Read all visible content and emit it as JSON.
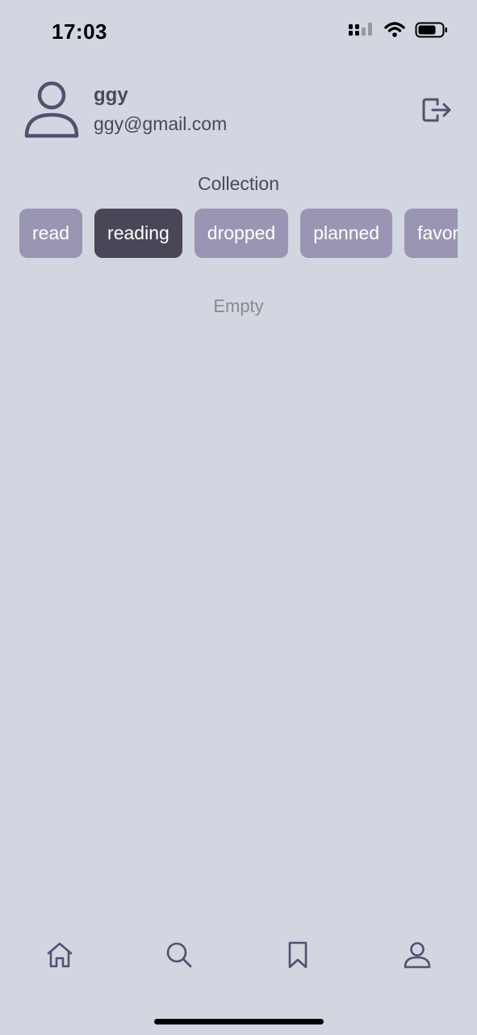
{
  "status_bar": {
    "time": "17:03",
    "icons": [
      "signal-icon",
      "wifi-icon",
      "battery-icon"
    ]
  },
  "profile": {
    "name": "ggy",
    "email": "ggy@gmail.com",
    "avatar_icon": "person-icon",
    "logout_icon": "logout-icon"
  },
  "collection": {
    "title": "Collection",
    "tabs": [
      {
        "label": "read",
        "active": false
      },
      {
        "label": "reading",
        "active": true
      },
      {
        "label": "dropped",
        "active": false
      },
      {
        "label": "planned",
        "active": false
      },
      {
        "label": "favorite",
        "active": false
      }
    ],
    "empty_text": "Empty"
  },
  "bottom_nav": {
    "items": [
      "home-icon",
      "search-icon",
      "bookmark-icon",
      "profile-icon"
    ]
  },
  "colors": {
    "background": "#d1d6e0",
    "tab_inactive": "#9a95b2",
    "tab_active": "#4a4658",
    "text_primary": "#4b4860"
  }
}
